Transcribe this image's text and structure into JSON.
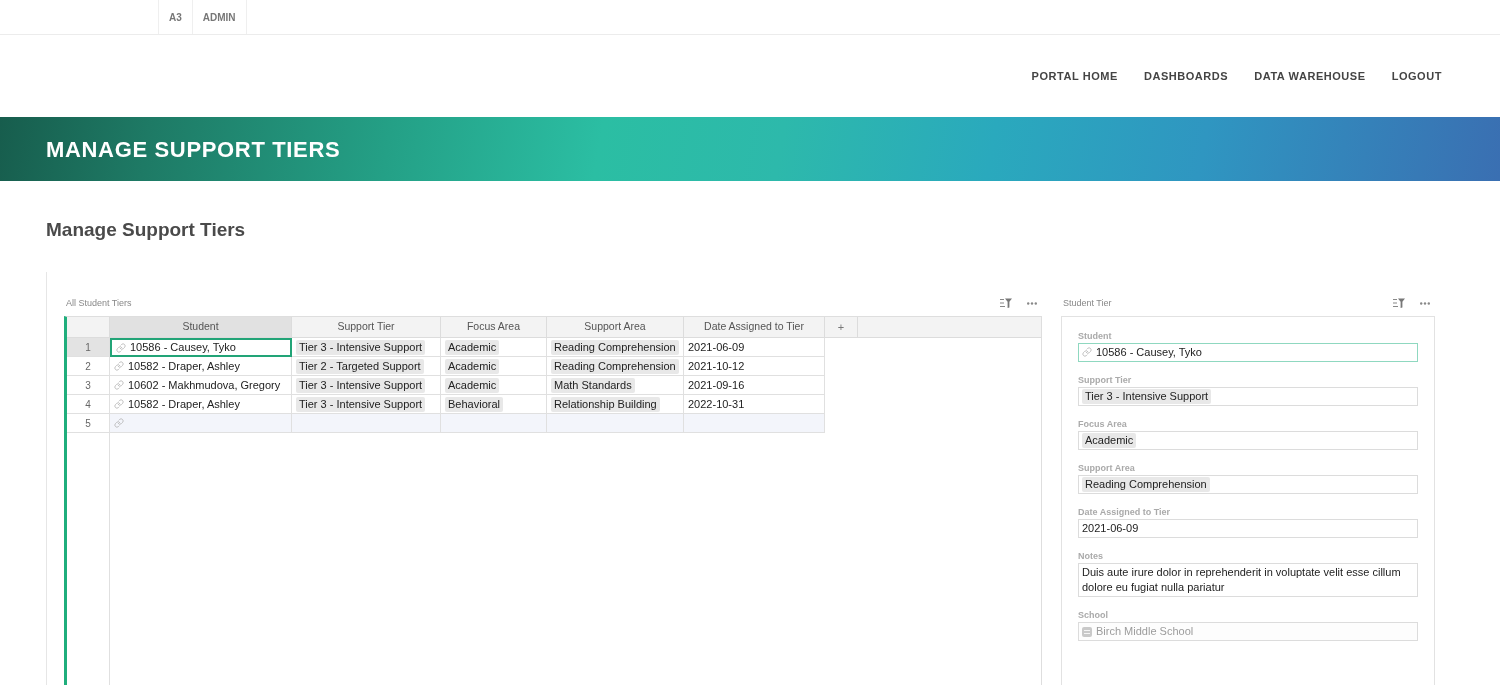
{
  "top_bar": {
    "links": [
      "A3",
      "ADMIN"
    ]
  },
  "nav": {
    "links": [
      "PORTAL HOME",
      "DASHBOARDS",
      "DATA WAREHOUSE",
      "LOGOUT"
    ]
  },
  "banner": {
    "title": "MANAGE SUPPORT TIERS"
  },
  "page_heading": "Manage Support Tiers",
  "table_widget": {
    "title": "All Student Tiers",
    "columns": [
      {
        "label": "Student",
        "kind": "reference",
        "selected": true
      },
      {
        "label": "Support Tier",
        "kind": "choice",
        "selected": false
      },
      {
        "label": "Focus Area",
        "kind": "choice",
        "selected": false
      },
      {
        "label": "Support Area",
        "kind": "choice",
        "selected": false
      },
      {
        "label": "Date Assigned to Tier",
        "kind": "date",
        "selected": false
      }
    ],
    "add_column": "+",
    "rows": [
      {
        "number": "1",
        "selected": true,
        "cells": [
          "10586 - Causey, Tyko",
          "Tier 3 - Intensive Support",
          "Academic",
          "Reading Comprehension",
          "2021-06-09"
        ]
      },
      {
        "number": "2",
        "selected": false,
        "cells": [
          "10582 - Draper, Ashley",
          "Tier 2 - Targeted Support",
          "Academic",
          "Reading Comprehension",
          "2021-10-12"
        ]
      },
      {
        "number": "3",
        "selected": false,
        "cells": [
          "10602 - Makhmudova, Gregory",
          "Tier 3 - Intensive Support",
          "Academic",
          "Math Standards",
          "2021-09-16"
        ]
      },
      {
        "number": "4",
        "selected": false,
        "cells": [
          "10582 - Draper, Ashley",
          "Tier 3 - Intensive Support",
          "Behavioral",
          "Relationship Building",
          "2022-10-31"
        ]
      }
    ],
    "new_row": {
      "number": "5"
    }
  },
  "record_card": {
    "title": "Student Tier",
    "fields": [
      {
        "label": "Student",
        "kind": "reference",
        "value": "10586 - Causey, Tyko",
        "focused": true,
        "disabled": false
      },
      {
        "label": "Support Tier",
        "kind": "choice",
        "value": "Tier 3 - Intensive Support",
        "focused": false,
        "disabled": false
      },
      {
        "label": "Focus Area",
        "kind": "choice",
        "value": "Academic",
        "focused": false,
        "disabled": false
      },
      {
        "label": "Support Area",
        "kind": "choice",
        "value": "Reading Comprehension",
        "focused": false,
        "disabled": false
      },
      {
        "label": "Date Assigned to Tier",
        "kind": "date",
        "value": "2021-06-09",
        "focused": false,
        "disabled": false
      },
      {
        "label": "Notes",
        "kind": "text",
        "value": "Duis aute irure dolor in reprehenderit in voluptate velit esse cillum dolore eu fugiat nulla pariatur",
        "focused": false,
        "disabled": false
      },
      {
        "label": "School",
        "kind": "lookup",
        "value": "Birch Middle School",
        "focused": false,
        "disabled": true
      }
    ]
  }
}
